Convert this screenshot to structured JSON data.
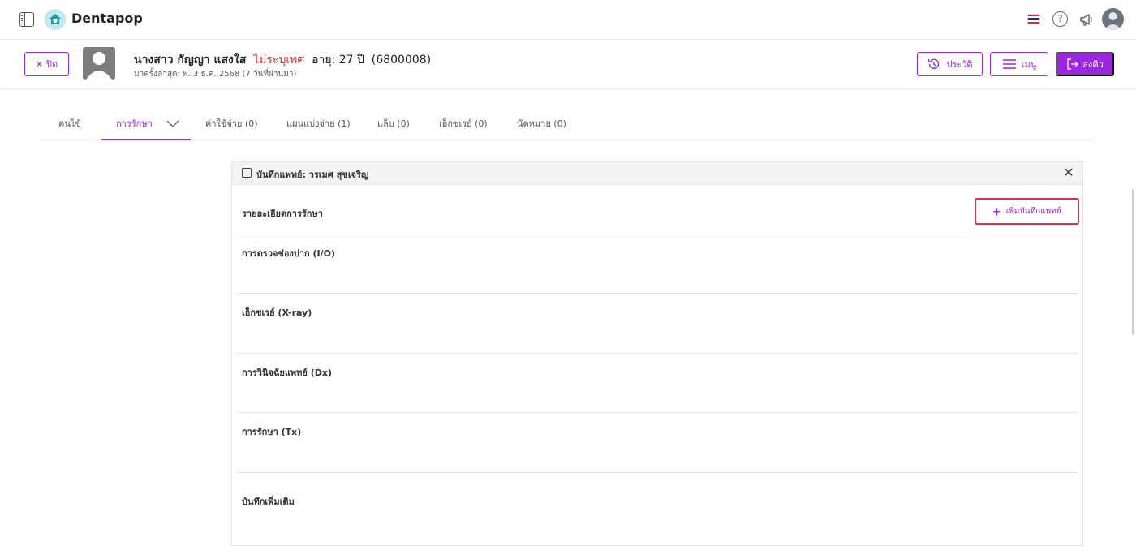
{
  "app": {
    "brand": "Dentapop"
  },
  "patient": {
    "name": "นางสาว กัญญา แสงใส",
    "gender": "ไม่ระบุเพศ",
    "age": "อายุ: 27 ปี",
    "code": "(6800008)",
    "last_visit": "มาครั้งล่าสุด: พ. 3 ธ.ค. 2568 (7 วันที่ผ่านมา)"
  },
  "header_actions": {
    "close_label": "ปิด",
    "history_label": "ประวัติ",
    "menu_label": "เมนู",
    "send_label": "ส่งคิว"
  },
  "tabs": [
    {
      "label": "คนไข้"
    },
    {
      "label": "การรักษา"
    },
    {
      "label": "ค่าใช้จ่าย (0)"
    },
    {
      "label": "แผนแบ่งจ่าย (1)"
    },
    {
      "label": "แล็บ (0)"
    },
    {
      "label": "เอ็กซเรย์ (0)"
    },
    {
      "label": "นัดหมาย (0)"
    }
  ],
  "panel": {
    "title": "บันทึกแพทย์: วรเมศ สุขเจริญ",
    "section_title": "รายละเอียดการรักษา",
    "add_button_label": "เพิ่มบันทึกแพทย์",
    "fields": [
      {
        "label": "การตรวจช่องปาก (I/O)"
      },
      {
        "label": "เอ็กซเรย์ (X-ray)"
      },
      {
        "label": "การวินิจฉัยแพทย์ (Dx)"
      },
      {
        "label": "การรักษา (Tx)"
      },
      {
        "label": "บันทึกเพิ่มเติม"
      }
    ]
  },
  "colors": {
    "accent": "#9c27e0",
    "gender_text": "#d32f2f",
    "highlight_border": "#d6334d"
  }
}
